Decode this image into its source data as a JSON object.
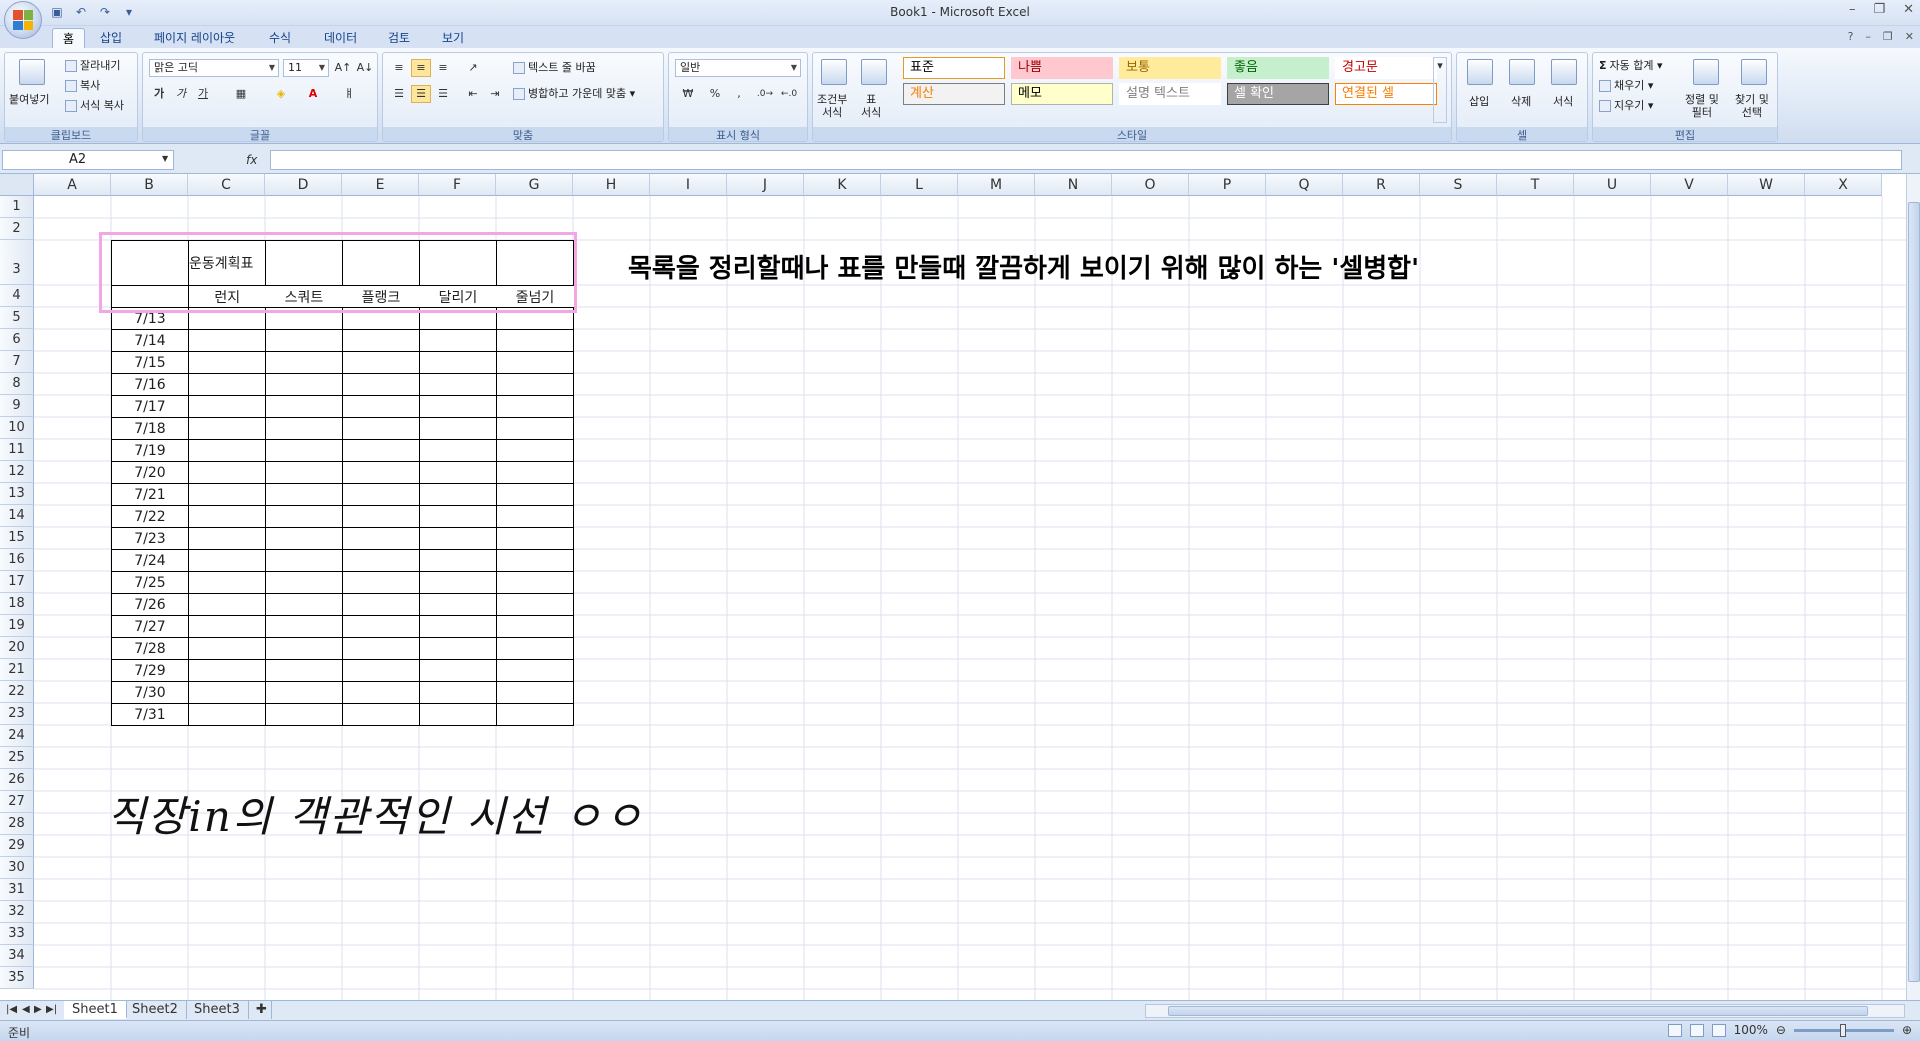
{
  "window": {
    "title": "Book1 - Microsoft Excel"
  },
  "ribbon_tabs": [
    "홈",
    "삽입",
    "페이지 레이아웃",
    "수식",
    "데이터",
    "검토",
    "보기"
  ],
  "clipboard": {
    "paste": "붙여넣기",
    "cut": "잘라내기",
    "copy": "복사",
    "format_painter": "서식 복사",
    "label": "클립보드"
  },
  "font": {
    "name": "맑은 고딕",
    "size": "11",
    "bold": "가",
    "italic": "가",
    "underline": "가",
    "label": "글꼴"
  },
  "alignment": {
    "wrap_text": "텍스트 줄 바꿈",
    "merge_center": "병합하고 가운데 맞춤",
    "label": "맞춤"
  },
  "number": {
    "format": "일반",
    "currency": "₩",
    "percent": "%",
    "comma": ",",
    "label": "표시 형식"
  },
  "styles": {
    "conditional": "조건부\n서식",
    "table": "표\n서식",
    "cells": [
      {
        "text": "표준",
        "bg": "#ffffff",
        "color": "#000000",
        "border": "#e39c1d"
      },
      {
        "text": "나쁨",
        "bg": "#ffc7ce",
        "color": "#9c0006",
        "border": "#ffc7ce"
      },
      {
        "text": "보통",
        "bg": "#ffeb9c",
        "color": "#9c6500",
        "border": "#ffeb9c"
      },
      {
        "text": "좋음",
        "bg": "#c6efce",
        "color": "#006100",
        "border": "#c6efce"
      },
      {
        "text": "경고문",
        "bg": "#ffffff",
        "color": "#c00000",
        "border": "#ffffff"
      },
      {
        "text": "계산",
        "bg": "#f2f2f2",
        "color": "#fa7d00",
        "border": "#7f7f7f"
      },
      {
        "text": "메모",
        "bg": "#ffffcc",
        "color": "#000000",
        "border": "#b2b2b2"
      },
      {
        "text": "설명 텍스트",
        "bg": "#ffffff",
        "color": "#7f7f7f",
        "border": "#ffffff"
      },
      {
        "text": "셀 확인",
        "bg": "#a5a5a5",
        "color": "#ffffff",
        "border": "#3f3f3f"
      },
      {
        "text": "연결된 셀",
        "bg": "#ffffff",
        "color": "#fa7d00",
        "border": "#ff8001"
      }
    ],
    "label": "스타일"
  },
  "cells_group": {
    "insert": "삽입",
    "delete": "삭제",
    "format": "서식",
    "label": "셀"
  },
  "editing": {
    "autosum": "자동 합계",
    "fill": "채우기",
    "clear": "지우기",
    "sort_filter": "정렬 및\n필터",
    "find_select": "찾기 및\n선택",
    "label": "편집"
  },
  "formula_bar": {
    "name_box": "A2",
    "fx": "fx",
    "value": ""
  },
  "columns": [
    "A",
    "B",
    "C",
    "D",
    "E",
    "F",
    "G",
    "H",
    "I",
    "J",
    "K",
    "L",
    "M",
    "N",
    "O",
    "P",
    "Q",
    "R",
    "S",
    "T",
    "U",
    "V",
    "W",
    "X"
  ],
  "rows": [
    "1",
    "2",
    "3",
    "4",
    "5",
    "6",
    "7",
    "8",
    "9",
    "10",
    "11",
    "12",
    "13",
    "14",
    "15",
    "16",
    "17",
    "18",
    "19",
    "20",
    "21",
    "22",
    "23",
    "24",
    "25",
    "26",
    "27",
    "28",
    "29",
    "30",
    "31",
    "32",
    "33",
    "34",
    "35"
  ],
  "table": {
    "title": "운동계획표",
    "headers": [
      "런지",
      "스쿼트",
      "플랭크",
      "달리기",
      "줄넘기"
    ],
    "dates": [
      "7/13",
      "7/14",
      "7/15",
      "7/16",
      "7/17",
      "7/18",
      "7/19",
      "7/20",
      "7/21",
      "7/22",
      "7/23",
      "7/24",
      "7/25",
      "7/26",
      "7/27",
      "7/28",
      "7/29",
      "7/30",
      "7/31"
    ]
  },
  "annotation": "목록을 정리할때나 표를 만들때 깔끔하게 보이기 위해 많이 하는 '셀병합'",
  "handwritten": "직장in의 객관적인 시선 ㅇㅇ",
  "sheets": [
    "Sheet1",
    "Sheet2",
    "Sheet3"
  ],
  "status": {
    "mode": "준비",
    "zoom": "100%"
  },
  "colors": {
    "highlight": "#f2a6e6",
    "accent": "#15428b"
  }
}
